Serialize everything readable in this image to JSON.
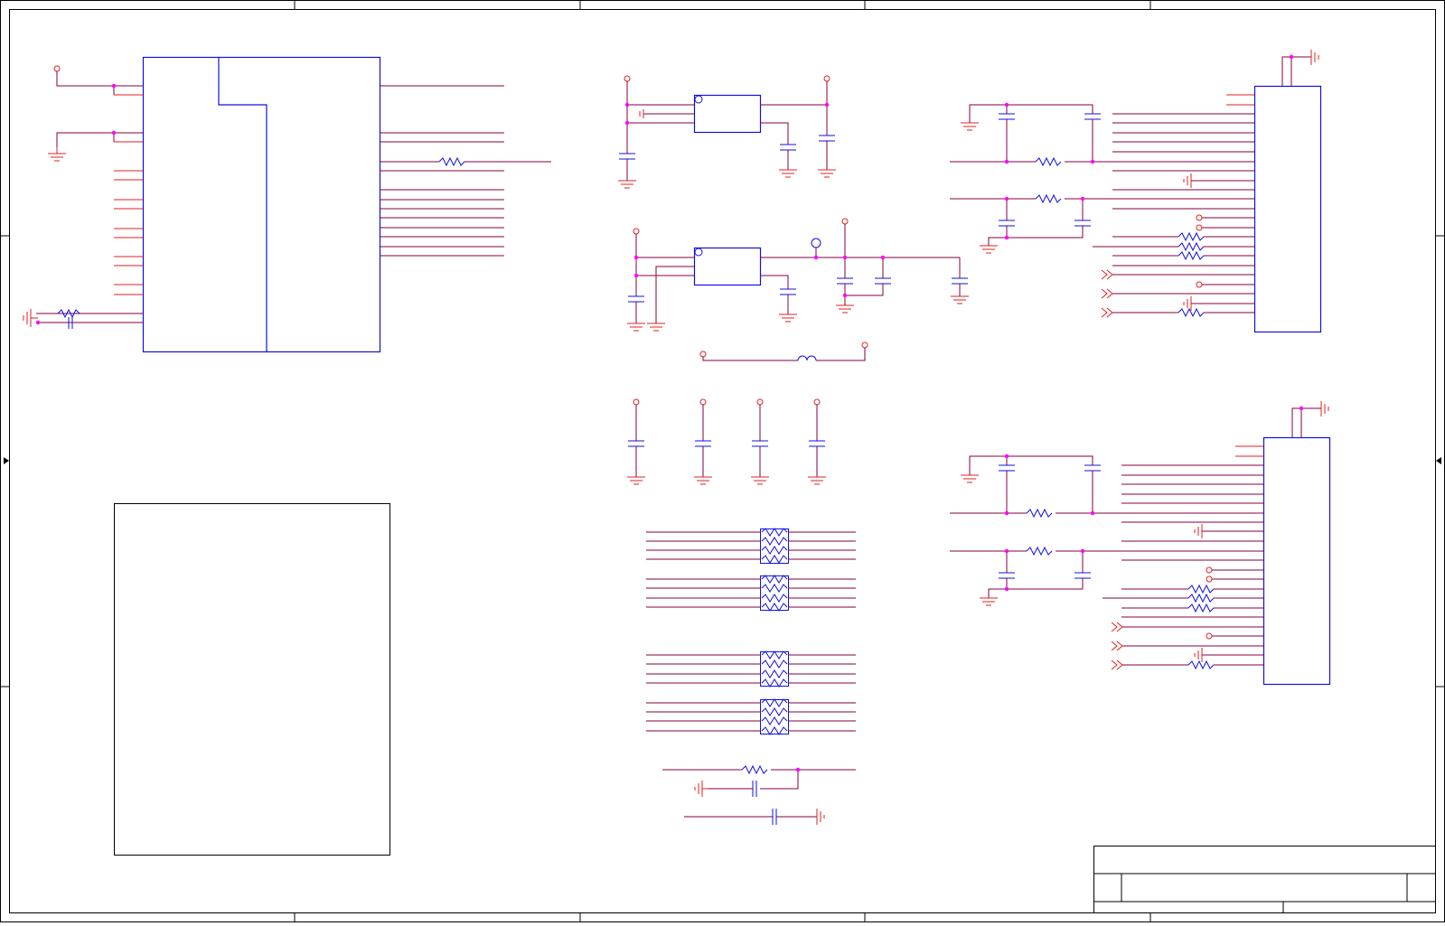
{
  "sheet": {
    "title": "",
    "colors": {
      "border": "#000000",
      "wire": "#e02020",
      "bus": "#800040",
      "component": "#1010e0",
      "junction": "#ff00ff",
      "background": "#ffffff"
    }
  },
  "title_block": {
    "title": "",
    "size": "",
    "document_number": "",
    "revision": "",
    "date": "",
    "sheet": ""
  },
  "components": [
    {
      "kind": "ic",
      "name": "main-ic"
    },
    {
      "kind": "regulator",
      "name": "regulator-1"
    },
    {
      "kind": "regulator",
      "name": "regulator-2"
    },
    {
      "kind": "connector",
      "name": "connector-1"
    },
    {
      "kind": "connector",
      "name": "connector-2"
    },
    {
      "kind": "resistor-array",
      "name": "resistor-arrays"
    },
    {
      "kind": "inductor",
      "name": "inductor"
    },
    {
      "kind": "notes-box",
      "name": "notes-box"
    }
  ]
}
